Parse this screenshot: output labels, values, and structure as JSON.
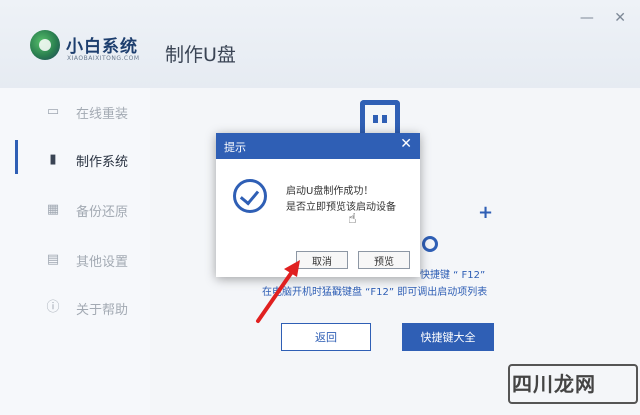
{
  "app": {
    "brand_name": "小白系统",
    "brand_sub": "XIAOBAIXITONG.COM",
    "page_title": "制作U盘",
    "min_icon": "minimize-icon",
    "close_icon": "close-icon"
  },
  "sidebar": {
    "items": [
      {
        "label": "在线重装",
        "icon": "monitor-icon"
      },
      {
        "label": "制作系统",
        "icon": "usb-icon",
        "active": true
      },
      {
        "label": "备份还原",
        "icon": "backup-icon"
      },
      {
        "label": "其他设置",
        "icon": "toolbox-icon"
      },
      {
        "label": "关于帮助",
        "icon": "info-icon"
      }
    ]
  },
  "content": {
    "hint_line_1": "快捷键 “ F12”",
    "hint_line_2": "在电脑开机时猛戳键盘 “F12” 即可调出启动项列表",
    "back_button": "返回",
    "hotkey_button": "快捷键大全"
  },
  "dialog": {
    "title": "提示",
    "message_1": "启动U盘制作成功！",
    "message_2": "是否立即预览该启动设备",
    "cancel_button": "取消",
    "preview_button": "预览"
  },
  "watermark": {
    "text": "四川龙网"
  },
  "colors": {
    "accent": "#2f5fb5",
    "annotation_arrow": "#e02020"
  }
}
